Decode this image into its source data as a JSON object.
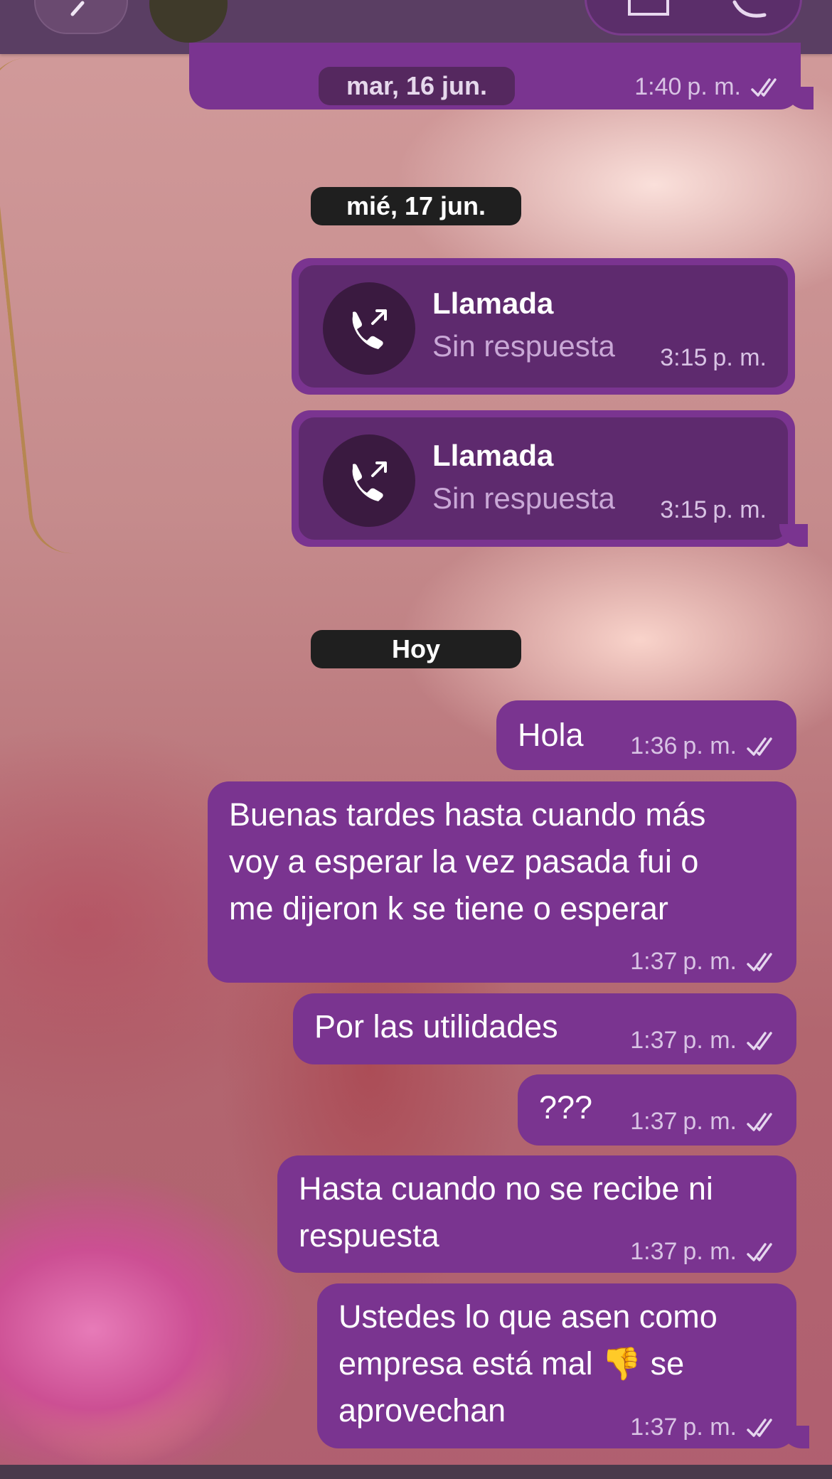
{
  "colors": {
    "bubble": "#7a3490",
    "pill_dark": "#1d1d1d",
    "call_inner": "#5e2a6e"
  },
  "header": {
    "back_icon": "chevron-left-icon",
    "video_icon": "video-icon",
    "phone_icon": "phone-icon"
  },
  "messages_prev": {
    "date": "mar, 16 jun.",
    "time": "1:40",
    "ampm": "p. m."
  },
  "section_jun17": {
    "date": "mié, 17 jun."
  },
  "calls": [
    {
      "title": "Llamada",
      "status": "Sin respuesta",
      "time": "3:15",
      "ampm": "p. m.",
      "icon": "outgoing-call-icon"
    },
    {
      "title": "Llamada",
      "status": "Sin respuesta",
      "time": "3:15",
      "ampm": "p. m.",
      "icon": "outgoing-call-icon"
    }
  ],
  "section_today": {
    "date": "Hoy"
  },
  "messages": [
    {
      "lines": [
        "Hola"
      ],
      "time": "1:36",
      "ampm": "p. m."
    },
    {
      "lines": [
        "Buenas tardes hasta cuando más",
        "voy a esperar la vez pasada fui o",
        "me dijeron k se tiene o esperar"
      ],
      "time": "1:37",
      "ampm": "p. m."
    },
    {
      "lines": [
        "Por las utilidades"
      ],
      "time": "1:37",
      "ampm": "p. m."
    },
    {
      "lines": [
        "???"
      ],
      "time": "1:37",
      "ampm": "p. m."
    },
    {
      "lines": [
        "Hasta cuando no se recibe ni",
        "respuesta"
      ],
      "time": "1:37",
      "ampm": "p. m."
    },
    {
      "lines": [
        "Ustedes lo que asen como",
        "empresa está mal 👎 se",
        "aprovechan"
      ],
      "time": "1:37",
      "ampm": "p. m."
    }
  ]
}
